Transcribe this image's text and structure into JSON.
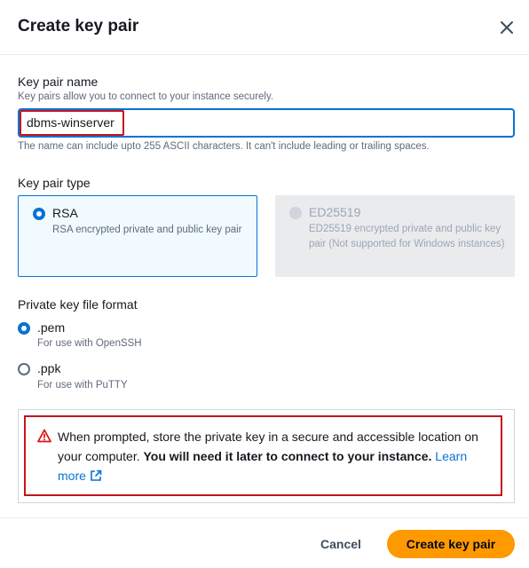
{
  "dialog": {
    "title": "Create key pair"
  },
  "key_pair_name": {
    "label": "Key pair name",
    "description": "Key pairs allow you to connect to your instance securely.",
    "value": "dbms-winserver",
    "constraint": "The name can include upto 255 ASCII characters. It can't include leading or trailing spaces."
  },
  "key_pair_type": {
    "label": "Key pair type",
    "options": [
      {
        "title": "RSA",
        "description": "RSA encrypted private and public key pair",
        "selected": true,
        "disabled": false
      },
      {
        "title": "ED25519",
        "description": "ED25519 encrypted private and public key pair (Not supported for Windows instances)",
        "selected": false,
        "disabled": true
      }
    ]
  },
  "file_format": {
    "label": "Private key file format",
    "options": [
      {
        "title": ".pem",
        "description": "For use with OpenSSH",
        "selected": true
      },
      {
        "title": ".ppk",
        "description": "For use with PuTTY",
        "selected": false
      }
    ]
  },
  "alert": {
    "text_normal": "When prompted, store the private key in a secure and accessible location on your computer.",
    "text_bold": "You will need it later to connect to your instance.",
    "link_text": "Learn more"
  },
  "footer": {
    "cancel_label": "Cancel",
    "create_label": "Create key pair"
  },
  "colors": {
    "primary_blue": "#0972d3",
    "orange_button": "#ff9900",
    "highlight_red": "#c7141c",
    "warning_red": "#d91515"
  }
}
